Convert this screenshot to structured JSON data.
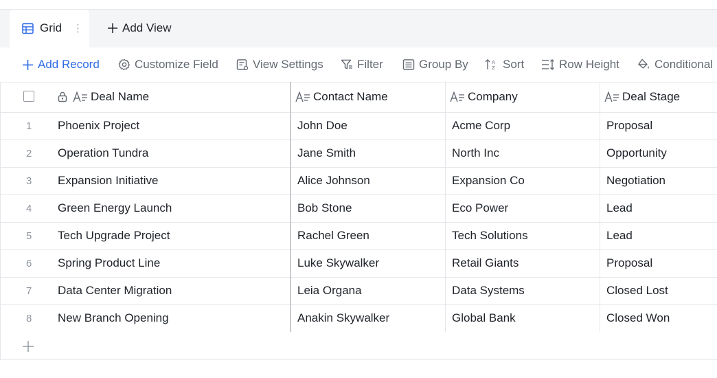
{
  "views": {
    "active_tab": {
      "label": "Grid",
      "icon": "grid-table-icon",
      "more": "⋮"
    },
    "add_view_label": "Add View"
  },
  "toolbar": {
    "add_record": "Add Record",
    "customize_field": "Customize Field",
    "view_settings": "View Settings",
    "filter": "Filter",
    "group_by": "Group By",
    "sort": "Sort",
    "row_height": "Row Height",
    "conditional": "Conditional"
  },
  "table": {
    "columns": [
      "Deal Name",
      "Contact Name",
      "Company",
      "Deal Stage"
    ],
    "rows": [
      {
        "num": "1",
        "deal": "Phoenix Project",
        "contact": "John Doe",
        "company": "Acme Corp",
        "stage": "Proposal"
      },
      {
        "num": "2",
        "deal": "Operation Tundra",
        "contact": "Jane Smith",
        "company": "North Inc",
        "stage": "Opportunity"
      },
      {
        "num": "3",
        "deal": "Expansion Initiative",
        "contact": "Alice Johnson",
        "company": "Expansion Co",
        "stage": "Negotiation"
      },
      {
        "num": "4",
        "deal": "Green Energy Launch",
        "contact": "Bob Stone",
        "company": "Eco Power",
        "stage": "Lead"
      },
      {
        "num": "5",
        "deal": "Tech Upgrade Project",
        "contact": "Rachel Green",
        "company": "Tech Solutions",
        "stage": "Lead"
      },
      {
        "num": "6",
        "deal": "Spring Product Line",
        "contact": "Luke Skywalker",
        "company": "Retail Giants",
        "stage": "Proposal"
      },
      {
        "num": "7",
        "deal": "Data Center Migration",
        "contact": "Leia Organa",
        "company": "Data Systems",
        "stage": "Closed Lost"
      },
      {
        "num": "8",
        "deal": "New Branch Opening",
        "contact": "Anakin Skywalker",
        "company": "Global Bank",
        "stage": "Closed Won"
      }
    ]
  },
  "colors": {
    "accent": "#2e6be6",
    "border": "#e4e6ea",
    "text": "#1f2329",
    "muted": "#646a73"
  }
}
